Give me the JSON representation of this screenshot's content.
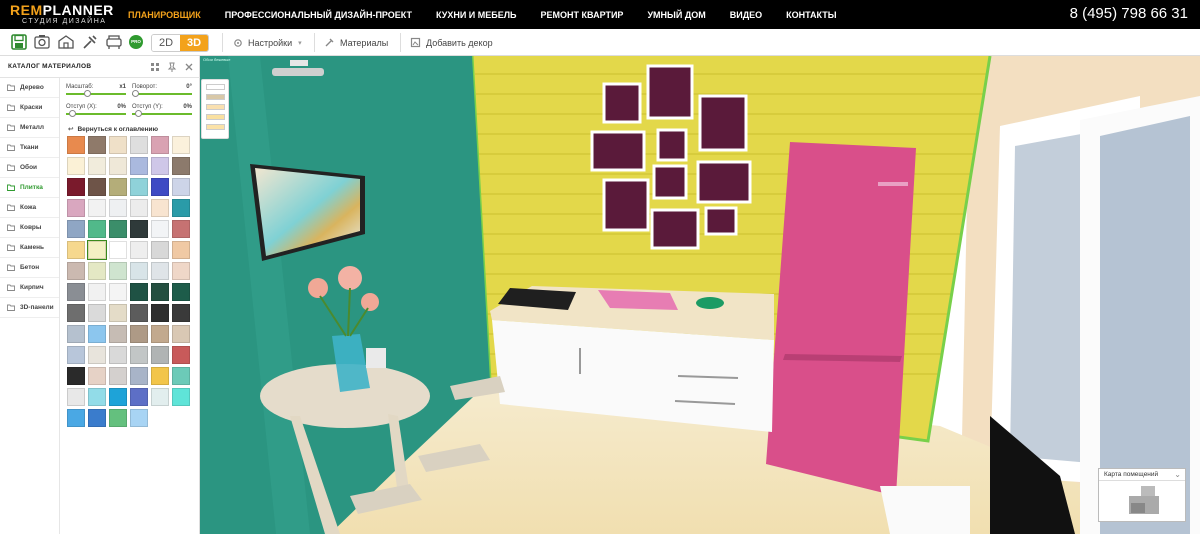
{
  "header": {
    "logo_main_a": "REM",
    "logo_main_b": "PLANNER",
    "logo_sub": "СТУДИЯ ДИЗАЙНА",
    "nav": [
      "ПЛАНИРОВЩИК",
      "ПРОФЕССИОНАЛЬНЫЙ ДИЗАЙН-ПРОЕКТ",
      "КУХНИ И МЕБЕЛЬ",
      "РЕМОНТ КВАРТИР",
      "УМНЫЙ ДОМ",
      "ВИДЕО",
      "КОНТАКТЫ"
    ],
    "phone": "8 (495) 798 66 31"
  },
  "toolbar": {
    "pro_badge": "PRO",
    "view_2d": "2D",
    "view_3d": "3D",
    "settings": "Настройки",
    "materials": "Материалы",
    "add_decor": "Добавить декор"
  },
  "panel": {
    "title": "КАТАЛОГ МАТЕРИАЛОВ",
    "categories": [
      "Дерево",
      "Краски",
      "Металл",
      "Ткани",
      "Обои",
      "Плитка",
      "Кожа",
      "Ковры",
      "Камень",
      "Бетон",
      "Кирпич",
      "3D-панели"
    ],
    "active_category": "Плитка",
    "scale_label": "Масштаб:",
    "scale_value": "x1",
    "rotate_label": "Поворот:",
    "rotate_value": "0°",
    "offset_x_label": "Отступ (X):",
    "offset_x_value": "0%",
    "offset_y_label": "Отступ (Y):",
    "offset_y_value": "0%",
    "back_link": "Вернуться к оглавлению"
  },
  "tiles": [
    "#e88a4e",
    "#8f7a6a",
    "#efe0c8",
    "#dedede",
    "#d9a2b2",
    "#fbf1dc",
    "#fbf1d6",
    "#f1ecdc",
    "#efe8d8",
    "#aab9de",
    "#cfc7e8",
    "#8c7a6c",
    "#7a1a2c",
    "#6e5448",
    "#b4ad79",
    "#8fd2d9",
    "#3e4ac4",
    "#cdd4e8",
    "#d9a7bf",
    "#f2f2f2",
    "#eef0f2",
    "#ececec",
    "#f8e4d0",
    "#2a9ba8",
    "#8fa6c4",
    "#51b98a",
    "#3b8e6a",
    "#2f3a3a",
    "#f2f4f6",
    "#c67272",
    "#f6d88e",
    "#f3f0c3",
    "#ffffff",
    "#eeeeee",
    "#d8d8d8",
    "#f0c9a4",
    "#cbb9b0",
    "#e4e8c4",
    "#cfe4cf",
    "#d8e4e8",
    "#dfe4e8",
    "#efd7c8",
    "#8a8e94",
    "#f1f1f1",
    "#f4f4f4",
    "#1f5244",
    "#244f40",
    "#1d5c4a",
    "#6e6e6e",
    "#dadada",
    "#e4dcc8",
    "#5c5c5c",
    "#2e2e2e",
    "#3a3a3a",
    "#b5c1cf",
    "#8cc6ee",
    "#c6bcb4",
    "#ae9a86",
    "#c2a98e",
    "#d9c8b4",
    "#b8c6da",
    "#e8e4dc",
    "#d9d9d9",
    "#c2c6c6",
    "#b0b4b4",
    "#c85a5a",
    "#2a2a2a",
    "#e6d2c6",
    "#d4d0ce",
    "#a8b4c8",
    "#f2c54a",
    "#6ccab8",
    "#e8e8e8",
    "#92dce8",
    "#1ea3d8",
    "#5d6fc6",
    "#e2eeee",
    "#5fe4d8",
    "#4aa8e4",
    "#3a7ccc",
    "#64c07e",
    "#a8d4f4"
  ],
  "selected_tile_index": 31,
  "swatch_colors": [
    "#ffffff",
    "#d8c8a8",
    "#f9e0b0",
    "#f9e0a0",
    "#fbe2a8"
  ],
  "wall_label": "Обои бежевые",
  "roommap": {
    "title": "Карта помещений"
  },
  "colors": {
    "accent": "#f3a21b",
    "green": "#2f9a2f",
    "teal_wall": "#2b9581",
    "yellow_wall": "#e3d84a",
    "fridge": "#d94f8a"
  }
}
